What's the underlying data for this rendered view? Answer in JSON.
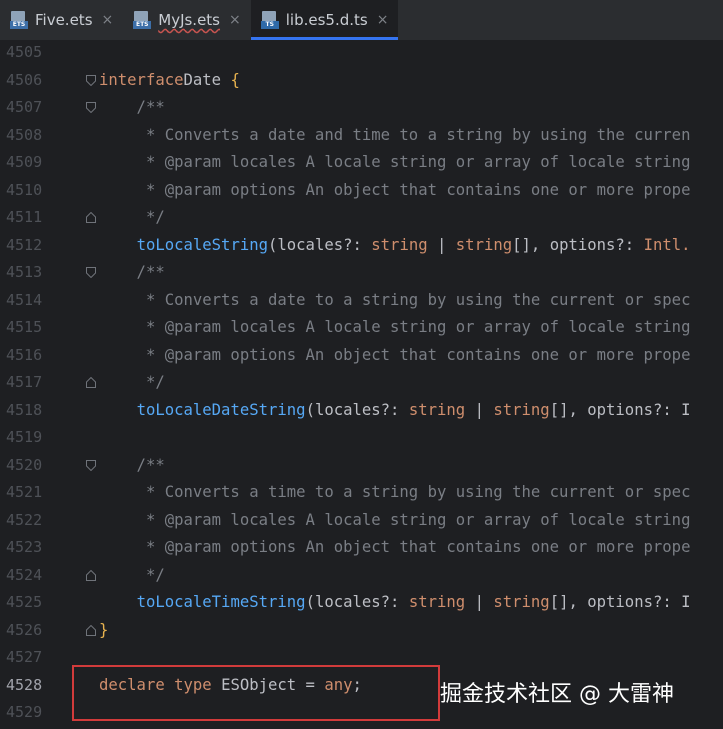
{
  "tabs": [
    {
      "name": "Five.ets",
      "badge": "ETS",
      "active": false
    },
    {
      "name": "MyJs.ets",
      "badge": "ETS",
      "active": false
    },
    {
      "name": "lib.es5.d.ts",
      "badge": "TS",
      "active": true
    }
  ],
  "tab_close_glyph": "×",
  "lines": [
    {
      "n": "4505",
      "tokens": []
    },
    {
      "n": "4506",
      "fold": "open",
      "tokens": [
        [
          "kw",
          "interface"
        ],
        [
          "",
          "Date "
        ],
        [
          "br",
          "{"
        ]
      ]
    },
    {
      "n": "4507",
      "fold": "open",
      "tokens": [
        [
          "cm",
          "    /**"
        ]
      ]
    },
    {
      "n": "4508",
      "tokens": [
        [
          "cm",
          "     * Converts a date and time to a string by using the curren"
        ]
      ]
    },
    {
      "n": "4509",
      "tokens": [
        [
          "cm",
          "     * @param locales A locale string or array of locale string"
        ]
      ]
    },
    {
      "n": "4510",
      "tokens": [
        [
          "cm",
          "     * @param options An object that contains one or more prope"
        ]
      ]
    },
    {
      "n": "4511",
      "fold": "close",
      "tokens": [
        [
          "cm",
          "     */"
        ]
      ]
    },
    {
      "n": "4512",
      "tokens": [
        [
          "",
          "    "
        ],
        [
          "fn",
          "toLocaleString"
        ],
        [
          "",
          "(locales?: "
        ],
        [
          "kw",
          "string"
        ],
        [
          "",
          " | "
        ],
        [
          "kw",
          "string"
        ],
        [
          "",
          "[], options?: "
        ],
        [
          "kw",
          "Intl."
        ]
      ]
    },
    {
      "n": "4513",
      "fold": "open",
      "tokens": [
        [
          "cm",
          "    /**"
        ]
      ]
    },
    {
      "n": "4514",
      "tokens": [
        [
          "cm",
          "     * Converts a date to a string by using the current or spec"
        ]
      ]
    },
    {
      "n": "4515",
      "tokens": [
        [
          "cm",
          "     * @param locales A locale string or array of locale string"
        ]
      ]
    },
    {
      "n": "4516",
      "tokens": [
        [
          "cm",
          "     * @param options An object that contains one or more prope"
        ]
      ]
    },
    {
      "n": "4517",
      "fold": "close",
      "tokens": [
        [
          "cm",
          "     */"
        ]
      ]
    },
    {
      "n": "4518",
      "tokens": [
        [
          "",
          "    "
        ],
        [
          "fn",
          "toLocaleDateString"
        ],
        [
          "",
          "(locales?: "
        ],
        [
          "kw",
          "string"
        ],
        [
          "",
          " | "
        ],
        [
          "kw",
          "string"
        ],
        [
          "",
          "[], options?: I"
        ]
      ]
    },
    {
      "n": "4519",
      "tokens": []
    },
    {
      "n": "4520",
      "fold": "open",
      "tokens": [
        [
          "cm",
          "    /**"
        ]
      ]
    },
    {
      "n": "4521",
      "tokens": [
        [
          "cm",
          "     * Converts a time to a string by using the current or spec"
        ]
      ]
    },
    {
      "n": "4522",
      "tokens": [
        [
          "cm",
          "     * @param locales A locale string or array of locale string"
        ]
      ]
    },
    {
      "n": "4523",
      "tokens": [
        [
          "cm",
          "     * @param options An object that contains one or more prope"
        ]
      ]
    },
    {
      "n": "4524",
      "fold": "close",
      "tokens": [
        [
          "cm",
          "     */"
        ]
      ]
    },
    {
      "n": "4525",
      "tokens": [
        [
          "",
          "    "
        ],
        [
          "fn",
          "toLocaleTimeString"
        ],
        [
          "",
          "(locales?: "
        ],
        [
          "kw",
          "string"
        ],
        [
          "",
          " | "
        ],
        [
          "kw",
          "string"
        ],
        [
          "",
          "[], options?: I"
        ]
      ]
    },
    {
      "n": "4526",
      "fold": "close",
      "tokens": [
        [
          "br",
          "}"
        ]
      ]
    },
    {
      "n": "4527",
      "tokens": []
    },
    {
      "n": "4528",
      "current": true,
      "tokens": [
        [
          "kw",
          "declare type "
        ],
        [
          "",
          "ESObject = "
        ],
        [
          "kw",
          "any"
        ],
        [
          "",
          ";"
        ]
      ]
    },
    {
      "n": "4529",
      "tokens": []
    }
  ],
  "watermark": "掘金技术社区 @ 大雷神",
  "colors": {
    "highlight_box": "#d23b3b",
    "active_tab_underline": "#3574f0",
    "keyword": "#cf8e6d",
    "function": "#56a8f5",
    "comment": "#7a7e85"
  }
}
